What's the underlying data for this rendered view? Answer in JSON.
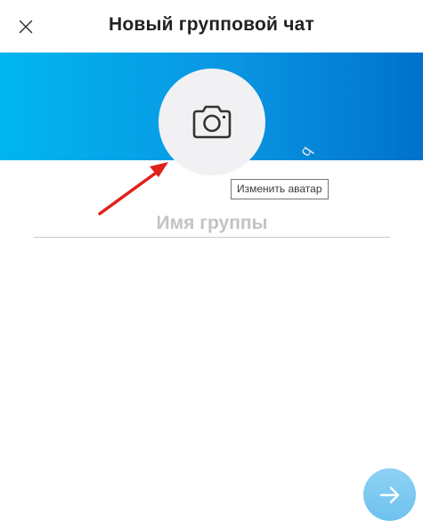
{
  "header": {
    "title": "Новый групповой чат",
    "close_icon": "close-icon"
  },
  "banner": {
    "gradient_start": "#00b6ef",
    "gradient_end": "#0072cc"
  },
  "avatar": {
    "icon": "camera-icon",
    "tooltip": "Изменить аватар"
  },
  "group_name": {
    "placeholder": "Имя группы",
    "value": ""
  },
  "next_button": {
    "icon": "arrow-right-icon",
    "color": "#7cc9f1"
  },
  "watermark": {
    "text": "q"
  },
  "annotation": {
    "color": "#e0201b"
  }
}
